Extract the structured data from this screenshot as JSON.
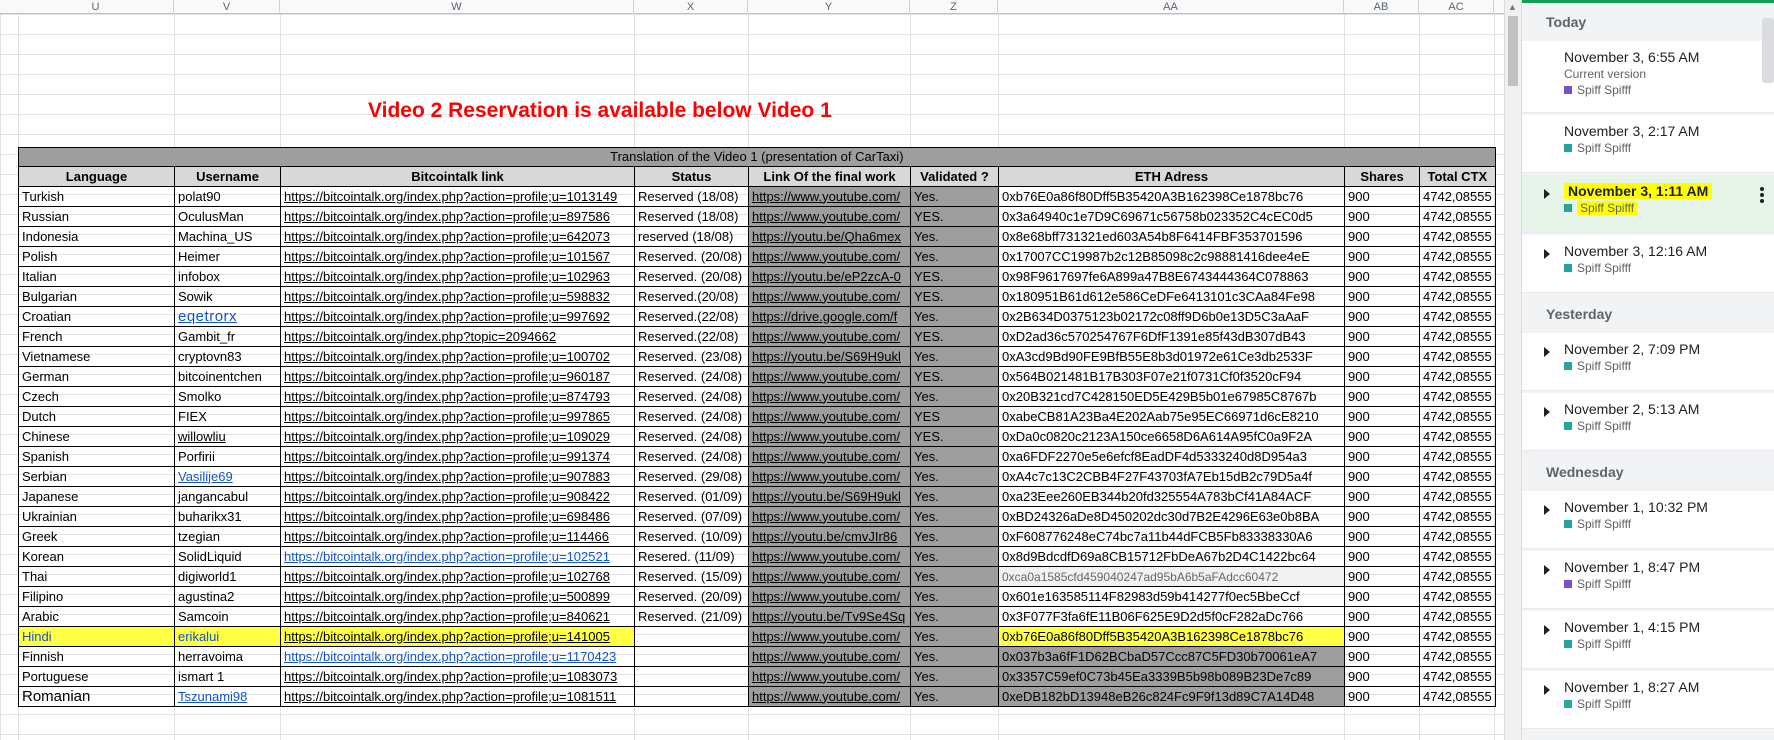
{
  "columns": [
    "U",
    "V",
    "W",
    "X",
    "Y",
    "Z",
    "AA",
    "AB",
    "AC"
  ],
  "banner": "Video 2 Reservation is available below Video 1",
  "table": {
    "title": "Translation of the Video 1 (presentation of CarTaxi)",
    "headers": [
      "Language",
      "Username",
      "Bitcointalk link",
      "Status",
      "Link Of the final work",
      "Validated ?",
      "ETH Adress",
      "Shares",
      "Total CTX"
    ],
    "rows": [
      [
        "Turkish",
        "polat90",
        "https://bitcointalk.org/index.php?action=profile;u=1013149",
        "Reserved (18/08)",
        "https://www.youtube.com/",
        "Yes.",
        "0xb76E0a86f80Dff5B35420A3B162398Ce1878bc76",
        "900",
        "4742,08555"
      ],
      [
        "Russian",
        "OculusMan",
        "https://bitcointalk.org/index.php?action=profile;u=897586",
        "Reserved (18/08)",
        "https://www.youtube.com/",
        "YES.",
        "0x3a64940c1e7D9C69671c56758b023352C4cEC0d5",
        "900",
        "4742,08555"
      ],
      [
        "Indonesia",
        "Machina_US",
        "https://bitcointalk.org/index.php?action=profile;u=642073",
        "reserved (18/08)",
        "https://youtu.be/Qha6mex",
        "Yes.",
        "0x8e68bff731321ed603A54b8F6414FBF353701596",
        "900",
        "4742,08555"
      ],
      [
        "Polish",
        "Heimer",
        "https://bitcointalk.org/index.php?action=profile;u=101567",
        "Reserved. (20/08)",
        "https://www.youtube.com/",
        "Yes.",
        "0x17007CC19987b2c12B85098c2c98881416dee4eE",
        "900",
        "4742,08555"
      ],
      [
        "Italian",
        "infobox",
        "https://bitcointalk.org/index.php?action=profile;u=102963",
        "Reserved. (20/08)",
        "https://youtu.be/eP2zcA-0",
        "YES.",
        "0x98F9617697fe6A899a47B8E6743444364C078863",
        "900",
        "4742,08555"
      ],
      [
        "Bulgarian",
        "Sowik",
        "https://bitcointalk.org/index.php?action=profile;u=598832",
        "Reserved.(20/08)",
        "https://www.youtube.com/",
        "YES.",
        "0x180951B61d612e586CeDFe6413101c3CAa84Fe98",
        "900",
        "4742,08555"
      ],
      [
        "Croatian",
        "eqetrorx",
        "https://bitcointalk.org/index.php?action=profile;u=997692",
        "Reserved.(22/08)",
        "https://drive.google.com/f",
        "Yes.",
        "0x2B634D0375123b02172c08ff9D6b0e13D5C3aAaF",
        "900",
        "4742,08555"
      ],
      [
        "French",
        "Gambit_fr",
        "https://bitcointalk.org/index.php?topic=2094662",
        "Reserved.(22/08)",
        "https://www.youtube.com/",
        "YES.",
        "0xD2ad36c570254767F6DfF1391e85f43dB307dB43",
        "900",
        "4742,08555"
      ],
      [
        "Vietnamese",
        "cryptovn83",
        "https://bitcointalk.org/index.php?action=profile;u=100702",
        "Reserved. (23/08)",
        "https://youtu.be/S69H9ukl",
        "Yes.",
        "0xA3cd9Bd90FE9BfB55E8b3d01972e61Ce3db2533F",
        "900",
        "4742,08555"
      ],
      [
        "German",
        "bitcoinentchen",
        "https://bitcointalk.org/index.php?action=profile;u=960187",
        "Reserved. (24/08)",
        "https://www.youtube.com/",
        "YES.",
        "0x564B021481B17B303F07e21f0731Cf0f3520cF94",
        "900",
        "4742,08555"
      ],
      [
        "Czech",
        "Smolko",
        "https://bitcointalk.org/index.php?action=profile;u=874793",
        "Reserved. (24/08)",
        "https://www.youtube.com/",
        "Yes.",
        "0x20B321cd7C428150ED5E429B5b01e67985C8767b",
        "900",
        "4742,08555"
      ],
      [
        "Dutch",
        "FIEX",
        "https://bitcointalk.org/index.php?action=profile;u=997865",
        "Reserved. (24/08)",
        "https://www.youtube.com/",
        "YES",
        "0xabeCB81A23Ba4E202Aab75e95EC66971d6cE8210",
        "900",
        "4742,08555"
      ],
      [
        "Chinese",
        "willowliu",
        "https://bitcointalk.org/index.php?action=profile;u=109029",
        "Reserved. (24/08)",
        "https://www.youtube.com/",
        "YES.",
        "0xDa0c0820c2123A150ce6658D6A614A95fC0a9F2A",
        "900",
        "4742,08555"
      ],
      [
        "Spanish",
        "Porfirii",
        "https://bitcointalk.org/index.php?action=profile;u=991374",
        "Reserved. (24/08)",
        "https://www.youtube.com/",
        "Yes.",
        "0xa6FDF2270e5e6efcf8EadDF4d5333240d8D954a3",
        "900",
        "4742,08555"
      ],
      [
        "Serbian",
        "Vasilije69",
        "https://bitcointalk.org/index.php?action=profile;u=907883",
        "Reserved. (29/08)",
        "https://www.youtube.com/",
        "Yes.",
        "0xA4c7c13C2CBB4F27F43703fA7Eb15dB2c79D5a4f",
        "900",
        "4742,08555"
      ],
      [
        "Japanese",
        "jangancabul",
        "https://bitcointalk.org/index.php?action=profile;u=908422",
        "Reserved. (01/09)",
        "https://youtu.be/S69H9ukl",
        "Yes.",
        "0xa23Eee260EB344b20fd325554A783bCf41A84ACF",
        "900",
        "4742,08555"
      ],
      [
        "Ukrainian",
        "buharikx31",
        "https://bitcointalk.org/index.php?action=profile;u=698486",
        "Reserved. (07/09)",
        "https://www.youtube.com/",
        "Yes.",
        "0xBD24326aDe8D450202dc30d7B2E4296E63e0b8BA",
        "900",
        "4742,08555"
      ],
      [
        "Greek",
        "tzegian",
        "https://bitcointalk.org/index.php?action=profile;u=114466",
        "Reserved. (10/09)",
        "https://youtu.be/cmvJIr86",
        "Yes.",
        "0xF608776248eC74bc7a11b44dFCB5Fb83338330A6",
        "900",
        "4742,08555"
      ],
      [
        "Korean",
        "SolidLiquid",
        "https://bitcointalk.org/index.php?action=profile;u=102521",
        "Resered. (11/09)",
        "https://www.youtube.com/",
        "Yes.",
        "0x8d9BdcdfD69a8CB15712FbDeA67b2D4C1422bc64",
        "900",
        "4742,08555"
      ],
      [
        "Thai",
        "digiworld1",
        "https://bitcointalk.org/index.php?action=profile;u=102768",
        "Reserved. (15/09)",
        "https://www.youtube.com/",
        "Yes.",
        "0xca0a1585cfd459040247ad95bA6b5aFAdcc60472",
        "900",
        "4742,08555"
      ],
      [
        "Filipino",
        "agustina2",
        "https://bitcointalk.org/index.php?action=profile;u=500899",
        "Reserved. (20/09)",
        "https://www.youtube.com/",
        "Yes.",
        "0x601e163585114F82983d59b414277f0ec5BbeCcf",
        "900",
        "4742,08555"
      ],
      [
        "Arabic",
        "Samcoin",
        "https://bitcointalk.org/index.php?action=profile;u=840621",
        "Reserved. (21/09)",
        "https://youtu.be/Tv9Se4Sq",
        "Yes.",
        "0x3F077F3fa6fE11B06F625E9D2d5f0cF282aDc766",
        "900",
        "4742,08555"
      ],
      [
        "Hindi",
        "erikalui",
        "https://bitcointalk.org/index.php?action=profile;u=141005",
        "",
        "https://www.youtube.com/",
        "Yes.",
        "0xb76E0a86f80Dff5B35420A3B162398Ce1878bc76",
        "900",
        "4742,08555"
      ],
      [
        "Finnish",
        "herravoima",
        "https://bitcointalk.org/index.php?action=profile;u=1170423",
        "",
        "https://www.youtube.com/",
        "Yes.",
        "0x037b3a6fF1D62BCbaD57Ccc87C5FD30b70061eA7",
        "900",
        "4742,08555"
      ],
      [
        "Portuguese",
        "ismart 1",
        "https://bitcointalk.org/index.php?action=profile;u=1083073",
        "",
        "https://www.youtube.com/",
        "Yes.",
        "0x3357C59ef0C73b45Ea3339B5b98b089B23De7c89",
        "900",
        "4742,08555"
      ],
      [
        "Romanian",
        "Tszunami98",
        "https://bitcointalk.org/index.php?action=profile;u=1081511",
        "",
        "https://www.youtube.com/",
        "Yes.",
        "0xeDB182bD13948eB26c824Fc9F9f13d89C7A14D48",
        "900",
        "4742,08555"
      ]
    ]
  },
  "panel": {
    "sections": [
      {
        "label": "Today",
        "versions": [
          {
            "date": "November 3, 6:55 AM",
            "current": "Current version",
            "user": "Spiff Spifff",
            "color": "#7b4fc4",
            "expandable": false,
            "selected": false
          },
          {
            "date": "November 3, 2:17 AM",
            "current": "",
            "user": "Spiff Spifff",
            "color": "#26a69a",
            "expandable": false,
            "selected": false
          },
          {
            "date": "November 3, 1:11 AM",
            "current": "",
            "user": "Spiff Spifff",
            "color": "#26a69a",
            "expandable": true,
            "selected": true
          },
          {
            "date": "November 3, 12:16 AM",
            "current": "",
            "user": "Spiff Spifff",
            "color": "#26a69a",
            "expandable": true,
            "selected": false
          }
        ]
      },
      {
        "label": "Yesterday",
        "versions": [
          {
            "date": "November 2, 7:09 PM",
            "current": "",
            "user": "Spiff Spifff",
            "color": "#26a69a",
            "expandable": true,
            "selected": false
          },
          {
            "date": "November 2, 5:13 AM",
            "current": "",
            "user": "Spiff Spifff",
            "color": "#26a69a",
            "expandable": true,
            "selected": false
          }
        ]
      },
      {
        "label": "Wednesday",
        "versions": [
          {
            "date": "November 1, 10:32 PM",
            "current": "",
            "user": "Spiff Spifff",
            "color": "#26a69a",
            "expandable": true,
            "selected": false
          },
          {
            "date": "November 1, 8:47 PM",
            "current": "",
            "user": "Spiff Spifff",
            "color": "#7b4fc4",
            "expandable": true,
            "selected": false
          },
          {
            "date": "November 1, 4:15 PM",
            "current": "",
            "user": "Spiff Spifff",
            "color": "#26a69a",
            "expandable": true,
            "selected": false
          },
          {
            "date": "November 1, 8:27 AM",
            "current": "",
            "user": "Spiff Spifff",
            "color": "#26a69a",
            "expandable": true,
            "selected": false
          }
        ]
      }
    ]
  },
  "colors": {
    "highlight": "#ffff44",
    "banner": "#ff0000",
    "header_gray": "#9e9e9e",
    "link_blue": "#1155cc",
    "accent_green": "#0f9d58"
  }
}
